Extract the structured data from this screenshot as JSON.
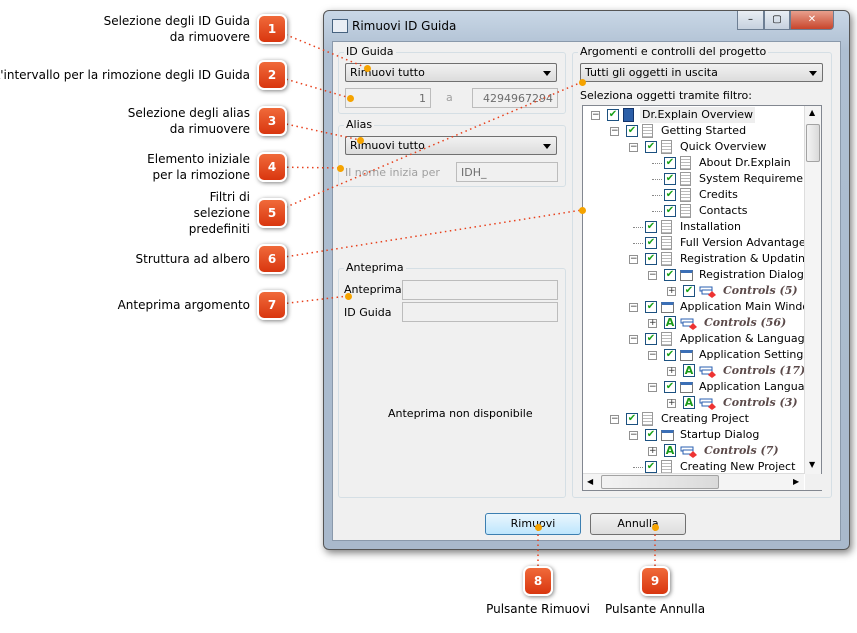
{
  "window": {
    "title": "Rimuovi ID Guida",
    "controls": [
      "–",
      "▢",
      "✕"
    ]
  },
  "idguida": {
    "group_label": "ID Guida",
    "combo_value": "Rimuovi tutto",
    "from_value": "1",
    "to_label": "a",
    "to_value": "4294967294"
  },
  "alias": {
    "group_label": "Alias",
    "combo_value": "Rimuovi tutto",
    "starts_label": "Il nome inizia per",
    "starts_value": "IDH_"
  },
  "preview": {
    "group_label": "Anteprima",
    "topic_label": "Anteprima",
    "id_label": "ID Guida",
    "topic_value": "",
    "id_value": "",
    "unavailable": "Anteprima non disponibile"
  },
  "project": {
    "group_label": "Argomenti e controlli del progetto",
    "filter_value": "Tutti gli oggetti in uscita",
    "tree_label": "Seleziona oggetti tramite filtro:"
  },
  "tree": [
    {
      "label": "Dr.Explain Overview",
      "level": 0,
      "icon": "book",
      "exp": "-",
      "checked": true
    },
    {
      "label": "Getting Started",
      "level": 1,
      "icon": "page",
      "exp": "-",
      "checked": true
    },
    {
      "label": "Quick Overview",
      "level": 2,
      "icon": "page",
      "exp": "-",
      "checked": true
    },
    {
      "label": "About Dr.Explain",
      "level": 3,
      "icon": "page",
      "exp": "",
      "checked": true
    },
    {
      "label": "System Requirements",
      "level": 3,
      "icon": "page",
      "exp": "",
      "checked": true
    },
    {
      "label": "Credits",
      "level": 3,
      "icon": "page",
      "exp": "",
      "checked": true
    },
    {
      "label": "Contacts",
      "level": 3,
      "icon": "page",
      "exp": "",
      "checked": true
    },
    {
      "label": "Installation",
      "level": 2,
      "icon": "page",
      "exp": "",
      "checked": true
    },
    {
      "label": "Full Version Advantages",
      "level": 2,
      "icon": "page",
      "exp": "",
      "checked": true
    },
    {
      "label": "Registration & Updating",
      "level": 2,
      "icon": "page",
      "exp": "-",
      "checked": true
    },
    {
      "label": "Registration Dialog",
      "level": 3,
      "icon": "window",
      "exp": "-",
      "checked": true
    },
    {
      "label": "Controls (5)",
      "level": 4,
      "icon": "controls",
      "exp": "+",
      "checked": true
    },
    {
      "label": "Application Main Window",
      "level": 2,
      "icon": "window",
      "exp": "-",
      "checked": true
    },
    {
      "label": "Controls (56)",
      "level": 3,
      "icon": "controls",
      "exp": "+",
      "checked": "A"
    },
    {
      "label": "Application & Language Se",
      "level": 2,
      "icon": "page",
      "exp": "-",
      "checked": true
    },
    {
      "label": "Application Settings W",
      "level": 3,
      "icon": "window",
      "exp": "-",
      "checked": true
    },
    {
      "label": "Controls (17)",
      "level": 4,
      "icon": "controls",
      "exp": "+",
      "checked": "A"
    },
    {
      "label": "Application Language",
      "level": 3,
      "icon": "window",
      "exp": "-",
      "checked": true
    },
    {
      "label": "Controls (3)",
      "level": 4,
      "icon": "controls",
      "exp": "+",
      "checked": "A"
    },
    {
      "label": "Creating Project",
      "level": 1,
      "icon": "page",
      "exp": "-",
      "checked": true
    },
    {
      "label": "Startup Dialog",
      "level": 2,
      "icon": "window",
      "exp": "-",
      "checked": true
    },
    {
      "label": "Controls (7)",
      "level": 3,
      "icon": "controls",
      "exp": "+",
      "checked": "A"
    },
    {
      "label": "Creating New Project",
      "level": 2,
      "icon": "page",
      "exp": "",
      "checked": true
    }
  ],
  "buttons": {
    "remove": "Rimuovi",
    "cancel": "Annulla"
  },
  "callouts": [
    {
      "n": "1",
      "text": "Selezione degli ID Guida\nda rimuovere"
    },
    {
      "n": "2",
      "text": "L'intervallo per la rimozione degli ID Guida"
    },
    {
      "n": "3",
      "text": "Selezione degli alias\nda rimuovere"
    },
    {
      "n": "4",
      "text": "Elemento iniziale\nper la rimozione"
    },
    {
      "n": "5",
      "text": "Filtri di\nselezione\npredefiniti"
    },
    {
      "n": "6",
      "text": "Struttura ad albero"
    },
    {
      "n": "7",
      "text": "Anteprima argomento"
    },
    {
      "n": "8",
      "text": "Pulsante Rimuovi"
    },
    {
      "n": "9",
      "text": "Pulsante Annulla"
    }
  ],
  "colors": {
    "badge": "#e4461b",
    "dot": "#f5a300",
    "line": "#e8401c"
  }
}
